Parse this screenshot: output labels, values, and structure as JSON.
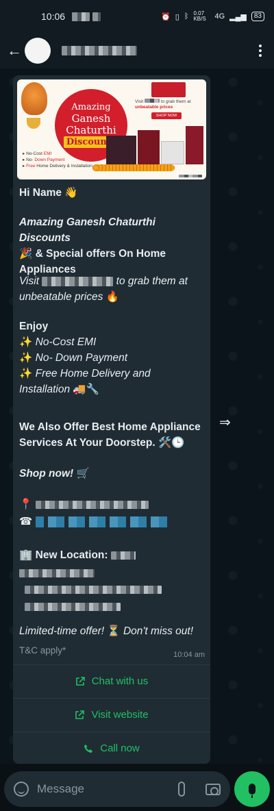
{
  "status_bar": {
    "time": "10:06",
    "net_speed": "0.07 KB/S",
    "network": "4G",
    "battery": "83"
  },
  "chat_header": {
    "contact_name": "██████ ███"
  },
  "message": {
    "greeting": "Hi Name",
    "greeting_emoji": "👋",
    "headline_italic": "Amazing Ganesh Chaturthi Discounts",
    "headline_emoji": "🎉",
    "headline_rest": " & Special offers On Home Appliances",
    "visit_prefix": "Visit",
    "visit_suffix": "to grab them at",
    "visit_line2": "unbeatable prices",
    "fire_emoji": "🔥",
    "enjoy": "Enjoy",
    "sparkle": "✨",
    "perk1": "No-Cost EMI",
    "perk2": "No- Down Payment",
    "perk3": "Free Home Delivery and",
    "perk3b": "Installation",
    "perk3_emoji": "🚚🔧",
    "services": "We Also Offer Best Home Appliance Services At Your Doorstep.",
    "services_emoji": "🛠️🕒",
    "shop_now": "Shop now!",
    "cart_emoji": "🛒",
    "pin_emoji": "📍",
    "phone_emoji": "☎",
    "location_emoji": "🏢",
    "new_location": "New Location:",
    "limited": "Limited-time offer!",
    "hourglass": "⏳",
    "dont_miss": "Don't miss out!",
    "tc": "T&C apply*",
    "timestamp": "10:04 am"
  },
  "banner": {
    "line1": "Amazing",
    "line2": "Ganesh",
    "line3": "Chaturthi",
    "line4": "Discounts",
    "perk1_a": "No-Cost ",
    "perk1_b": "EMI",
    "perk2_a": "No- ",
    "perk2_b": "Down Payment",
    "perk3_a": "Free ",
    "perk3_b": "Home Delivery & Installation",
    "visit_text": "Visit ",
    "visit_rest": " to grab them at ",
    "unbeatable": "unbeatable prices",
    "shop_button": "SHOP NOW"
  },
  "buttons": {
    "chat": "Chat with us",
    "visit": "Visit website",
    "call": "Call now"
  },
  "composer": {
    "placeholder": "Message"
  },
  "colors": {
    "accent_green": "#21c063",
    "bubble": "#1f2c34",
    "background": "#0b141a"
  }
}
